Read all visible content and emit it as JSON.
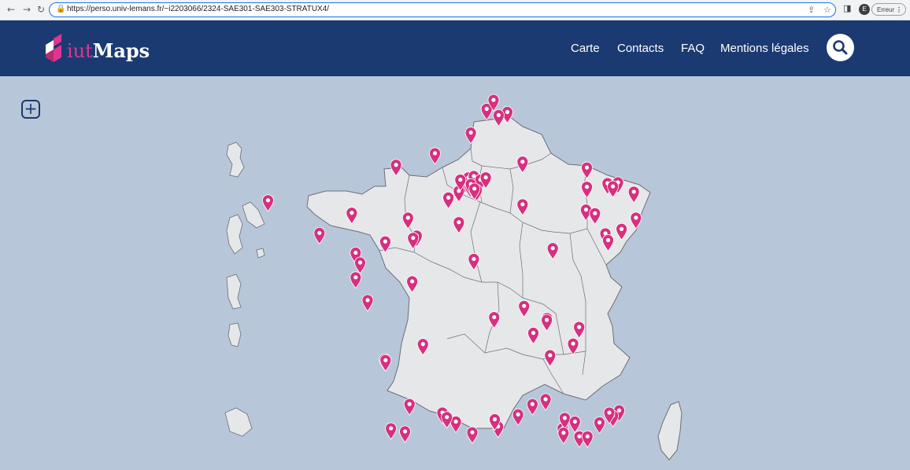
{
  "browser": {
    "url": "https://perso.univ-lemans.fr/~i2203066/2324-SAE301-SAE303-STRATUX4/",
    "profile_initial": "E",
    "error_label": "Erreur",
    "icons": [
      "back-icon",
      "forward-icon",
      "reload-icon",
      "lock-icon",
      "share-icon",
      "star-icon",
      "side-panel-icon",
      "kebab-menu-icon"
    ]
  },
  "header": {
    "logo_prefix": "iut",
    "logo_name": "Maps",
    "nav": [
      "Carte",
      "Contacts",
      "FAQ",
      "Mentions légales"
    ],
    "search_icon": "search-icon",
    "colors": {
      "header_bg": "#1b3a72",
      "accent": "#e0358f",
      "map_bg": "#b8c6d9",
      "land": "#e6e7e9"
    }
  },
  "map": {
    "zoom_label": "+",
    "marker_color": "#d6307f",
    "markers": [
      {
        "lon": 2.83,
        "lat": 50.43
      },
      {
        "lon": 3.06,
        "lat": 50.63
      },
      {
        "lon": 3.52,
        "lat": 50.36
      },
      {
        "lon": 3.23,
        "lat": 50.29
      },
      {
        "lon": 2.3,
        "lat": 49.9
      },
      {
        "lon": 2.1,
        "lat": 48.8
      },
      {
        "lon": 2.35,
        "lat": 48.86
      },
      {
        "lon": 2.45,
        "lat": 48.79
      },
      {
        "lon": 2.52,
        "lat": 48.85
      },
      {
        "lon": 2.22,
        "lat": 48.9
      },
      {
        "lon": 2.4,
        "lat": 48.93
      },
      {
        "lon": 2.28,
        "lat": 48.7
      },
      {
        "lon": 2.62,
        "lat": 48.85
      },
      {
        "lon": 2.5,
        "lat": 48.62
      },
      {
        "lon": 2.8,
        "lat": 48.9
      },
      {
        "lon": 1.9,
        "lat": 48.6
      },
      {
        "lon": 1.55,
        "lat": 48.45
      },
      {
        "lon": 1.95,
        "lat": 48.85
      },
      {
        "lon": 2.3,
        "lat": 48.75
      },
      {
        "lon": 2.42,
        "lat": 48.65
      },
      {
        "lon": 4.03,
        "lat": 48.3
      },
      {
        "lon": 4.03,
        "lat": 49.25
      },
      {
        "lon": 6.18,
        "lat": 49.12
      },
      {
        "lon": 6.18,
        "lat": 48.69
      },
      {
        "lon": 6.87,
        "lat": 48.77
      },
      {
        "lon": 7.22,
        "lat": 48.79
      },
      {
        "lon": 7.05,
        "lat": 48.7
      },
      {
        "lon": 6.15,
        "lat": 48.18
      },
      {
        "lon": 6.45,
        "lat": 48.1
      },
      {
        "lon": 7.75,
        "lat": 48.58
      },
      {
        "lon": 7.34,
        "lat": 47.75
      },
      {
        "lon": 7.82,
        "lat": 48.0
      },
      {
        "lon": 6.8,
        "lat": 47.65
      },
      {
        "lon": 6.89,
        "lat": 47.5
      },
      {
        "lon": -4.48,
        "lat": 48.39
      },
      {
        "lon": -2.76,
        "lat": 47.66
      },
      {
        "lon": -1.68,
        "lat": 48.11
      },
      {
        "lon": -1.55,
        "lat": 47.22
      },
      {
        "lon": -1.4,
        "lat": 47.0
      },
      {
        "lon": -1.55,
        "lat": 46.67
      },
      {
        "lon": -0.56,
        "lat": 47.47
      },
      {
        "lon": 0.2,
        "lat": 48.0
      },
      {
        "lon": 0.49,
        "lat": 47.6
      },
      {
        "lon": 0.37,
        "lat": 47.55
      },
      {
        "lon": 1.9,
        "lat": 47.9
      },
      {
        "lon": 2.4,
        "lat": 47.08
      },
      {
        "lon": 3.08,
        "lat": 45.78
      },
      {
        "lon": 4.85,
        "lat": 45.76
      },
      {
        "lon": 4.39,
        "lat": 45.43
      },
      {
        "lon": 5.72,
        "lat": 45.19
      },
      {
        "lon": 5.04,
        "lat": 47.32
      },
      {
        "lon": 4.84,
        "lat": 45.72
      },
      {
        "lon": 4.95,
        "lat": 44.93
      },
      {
        "lon": 5.92,
        "lat": 45.56
      },
      {
        "lon": 5.37,
        "lat": 43.3
      },
      {
        "lon": 5.44,
        "lat": 43.53
      },
      {
        "lon": 5.4,
        "lat": 43.2
      },
      {
        "lon": 5.93,
        "lat": 43.12
      },
      {
        "lon": 6.2,
        "lat": 43.12
      },
      {
        "lon": 7.26,
        "lat": 43.7
      },
      {
        "lon": 7.05,
        "lat": 43.58
      },
      {
        "lon": 6.93,
        "lat": 43.65
      },
      {
        "lon": 6.6,
        "lat": 43.43
      },
      {
        "lon": 4.8,
        "lat": 43.95
      },
      {
        "lon": 4.36,
        "lat": 43.84
      },
      {
        "lon": 3.88,
        "lat": 43.61
      },
      {
        "lon": 3.21,
        "lat": 43.34
      },
      {
        "lon": 2.35,
        "lat": 43.21
      },
      {
        "lon": 1.44,
        "lat": 43.6
      },
      {
        "lon": 1.35,
        "lat": 43.65
      },
      {
        "lon": 0.1,
        "lat": 43.23
      },
      {
        "lon": -0.37,
        "lat": 43.3
      },
      {
        "lon": -0.58,
        "lat": 44.84
      },
      {
        "lon": -0.55,
        "lat": 44.82
      },
      {
        "lon": 0.7,
        "lat": 45.18
      },
      {
        "lon": 0.34,
        "lat": 46.58
      },
      {
        "lon": -1.15,
        "lat": 46.16
      },
      {
        "lon": -0.2,
        "lat": 49.18
      },
      {
        "lon": 1.1,
        "lat": 49.44
      },
      {
        "lon": 0.25,
        "lat": 43.84
      },
      {
        "lon": 4.08,
        "lat": 46.03
      },
      {
        "lon": 3.1,
        "lat": 43.5
      },
      {
        "lon": 5.78,
        "lat": 43.45
      },
      {
        "lon": 1.8,
        "lat": 43.45
      },
      {
        "lon": 1.5,
        "lat": 43.55
      }
    ]
  }
}
